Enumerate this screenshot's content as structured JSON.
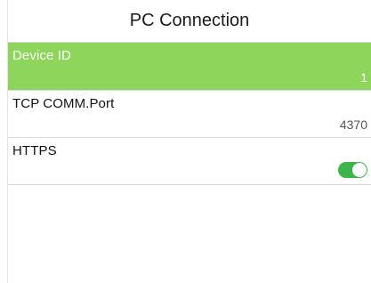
{
  "header": {
    "title": "PC Connection"
  },
  "settings": {
    "items": [
      {
        "label": "Device ID",
        "value": "1",
        "selected": true
      },
      {
        "label": "TCP COMM.Port",
        "value": "4370",
        "selected": false
      },
      {
        "label": "HTTPS",
        "toggle_on": true,
        "selected": false
      }
    ]
  },
  "colors": {
    "selected_row": "#8dd65b",
    "toggle_on": "#3cb54a",
    "divider": "#d8d8d8"
  },
  "icons": {
    "https_toggle": "toggle-switch-on-icon"
  }
}
